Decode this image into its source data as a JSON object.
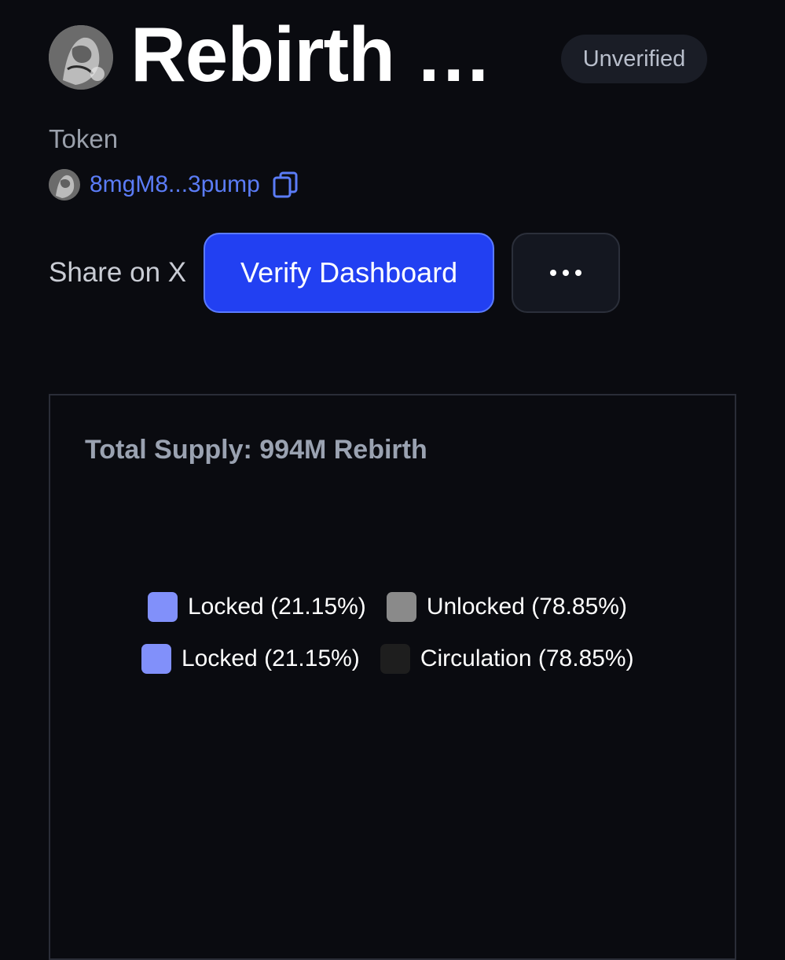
{
  "header": {
    "title": "Rebirth …",
    "badge": "Unverified",
    "avatar_icon": "token-avatar-image"
  },
  "token": {
    "type_label": "Token",
    "address_short": "8mgM8...3pump",
    "copy_icon": "copy-icon"
  },
  "actions": {
    "share_label": "Share on X",
    "verify_label": "Verify Dashboard",
    "more_icon": "ellipsis-icon"
  },
  "supply_card": {
    "title": "Total Supply: 994M Rebirth",
    "legend_rows": [
      [
        {
          "label": "Locked (21.15%)",
          "color": "#8190fa"
        },
        {
          "label": "Unlocked (78.85%)",
          "color": "#8a8a8a"
        }
      ],
      [
        {
          "label": "Locked (21.15%)",
          "color": "#8190fa"
        },
        {
          "label": "Circulation (78.85%)",
          "color": "#1e1e1e"
        }
      ]
    ]
  },
  "colors": {
    "background": "#0a0b10",
    "accent": "#2240f2",
    "link": "#5b7cf7",
    "muted": "#9aa0ab"
  }
}
